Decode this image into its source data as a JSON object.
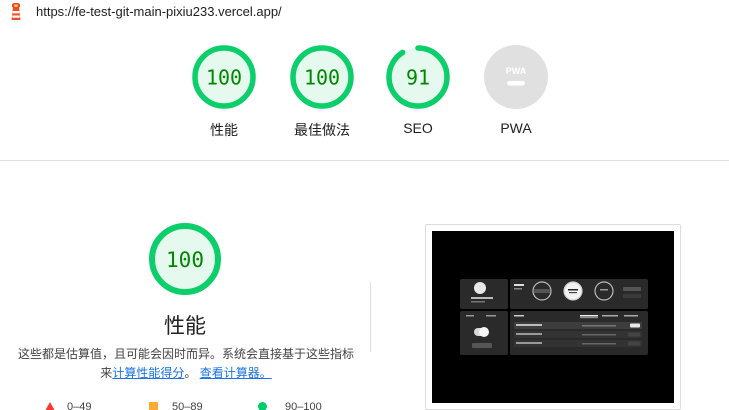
{
  "header": {
    "url": "https://fe-test-git-main-pixiu233.vercel.app/"
  },
  "summary": {
    "gauges": [
      {
        "score": "100",
        "label": "性能",
        "fraction": 1.0
      },
      {
        "score": "100",
        "label": "最佳做法",
        "fraction": 1.0
      },
      {
        "score": "91",
        "label": "SEO",
        "fraction": 0.91
      },
      {
        "score": "PWA",
        "label": "PWA"
      }
    ]
  },
  "performance": {
    "score": "100",
    "fraction": 1.0,
    "title": "性能",
    "desc_prefix": "这些都是估算值，且可能会因时而异。系统会直接基于这些指标来",
    "link_calc": "计算性能得分",
    "desc_mid": "。",
    "link_view": "查看计算器。"
  },
  "legend": {
    "fail": "0–49",
    "average": "50–89",
    "pass": "90–100"
  },
  "colors": {
    "pass": "#0cce6b",
    "pass_fill": "#e5f9ee",
    "pass_text": "#008800",
    "average": "#ffa400",
    "fail": "#ff4e42",
    "link": "#1a73e8"
  }
}
